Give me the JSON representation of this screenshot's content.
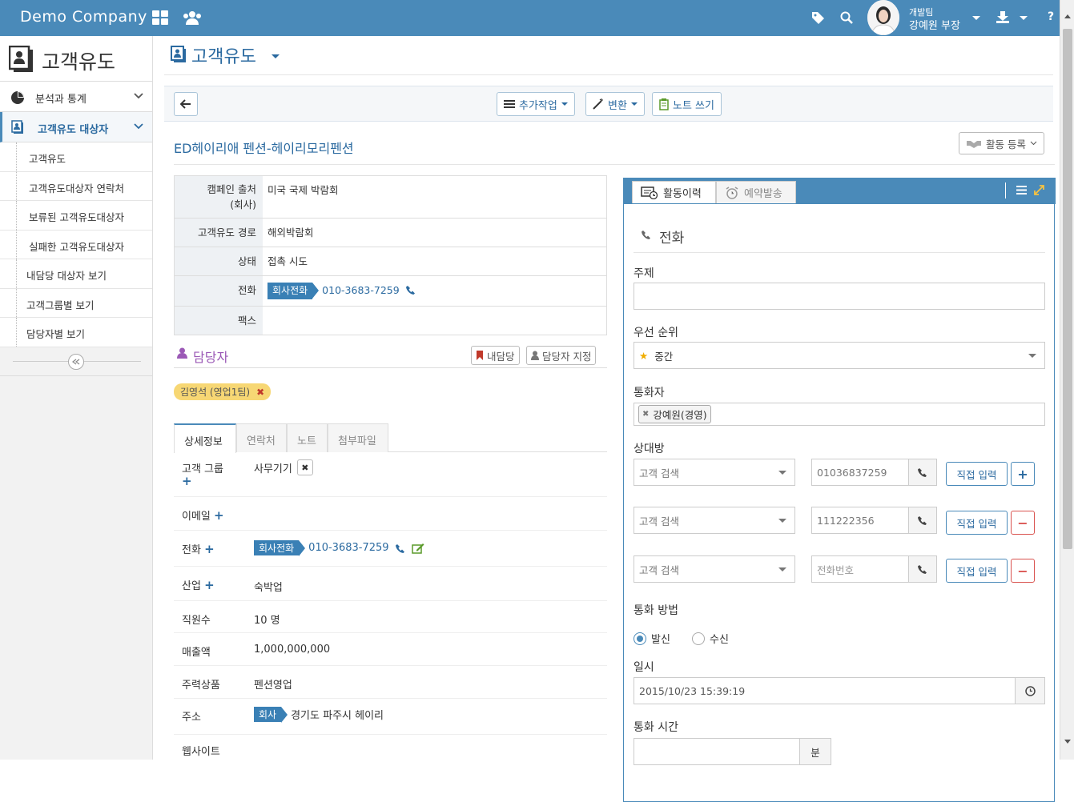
{
  "topbar": {
    "brand": "Demo Company",
    "team": "개발팀",
    "user": "강예원 부장"
  },
  "sidebar": {
    "title": "고객유도",
    "menus": [
      {
        "label": "분석과 통계"
      },
      {
        "label": "고객유도 대상자"
      }
    ],
    "subs": [
      "고객유도",
      "고객유도대상자 연락처",
      "보류된 고객유도대상자",
      "실패한 고객유도대상자",
      "내담당 대상자 보기",
      "고객그룹별 보기",
      "담당자별 보기"
    ]
  },
  "main": {
    "page_title": "고객유도",
    "toolbar": {
      "more": "추가작업",
      "convert": "변환",
      "note": "노트 쓰기"
    },
    "record_title": "ED헤이리애 펜션-헤이리모리펜션",
    "activity_btn": "활동 등록",
    "info": [
      {
        "k": "캠페인 출처 (회사)",
        "v": "미국 국제 박람회"
      },
      {
        "k": "고객유도 경로",
        "v": "해외박람회"
      },
      {
        "k": "상태",
        "v": "접촉 시도"
      },
      {
        "k": "전화",
        "tag": "회사전화",
        "v": "010-3683-7259"
      },
      {
        "k": "팩스",
        "v": ""
      }
    ],
    "owner_title": "담당자",
    "mine_btn": "내담당",
    "assign_btn": "담당자 지정",
    "owner_chip": "김영석 (영업1팀)",
    "tabs": [
      "상세정보",
      "연락처",
      "노트",
      "첨부파일"
    ],
    "details": {
      "group_k": "고객 그룹",
      "group_v": "사무기기",
      "email_k": "이메일",
      "phone_k": "전화",
      "phone_tag": "회사전화",
      "phone_v": "010-3683-7259",
      "industry_k": "산업",
      "industry_v": "숙박업",
      "emp_k": "직원수",
      "emp_v": "10 명",
      "sales_k": "매출액",
      "sales_v": "1,000,000,000",
      "product_k": "주력상품",
      "product_v": "펜션영업",
      "addr_k": "주소",
      "addr_tag": "회사",
      "addr_v": "경기도 파주시 헤이리",
      "web_k": "웹사이트"
    }
  },
  "panel": {
    "tab_history": "활동이력",
    "tab_reserve": "예약발송",
    "heading": "전화",
    "subject_label": "주제",
    "priority_label": "우선 순위",
    "priority_value": "중간",
    "caller_label": "통화자",
    "caller_chip": "강예원(경영)",
    "counterpart_label": "상대방",
    "search_placeholder": "고객 검색",
    "direct_btn": "직접 입력",
    "phones": [
      "01036837259",
      "111222356"
    ],
    "phone_placeholder": "전화번호",
    "method_label": "통화 방법",
    "out": "발신",
    "in": "수신",
    "datetime_label": "일시",
    "datetime_value": "2015/10/23 15:39:19",
    "duration_label": "통화 시간",
    "duration_unit": "분"
  }
}
